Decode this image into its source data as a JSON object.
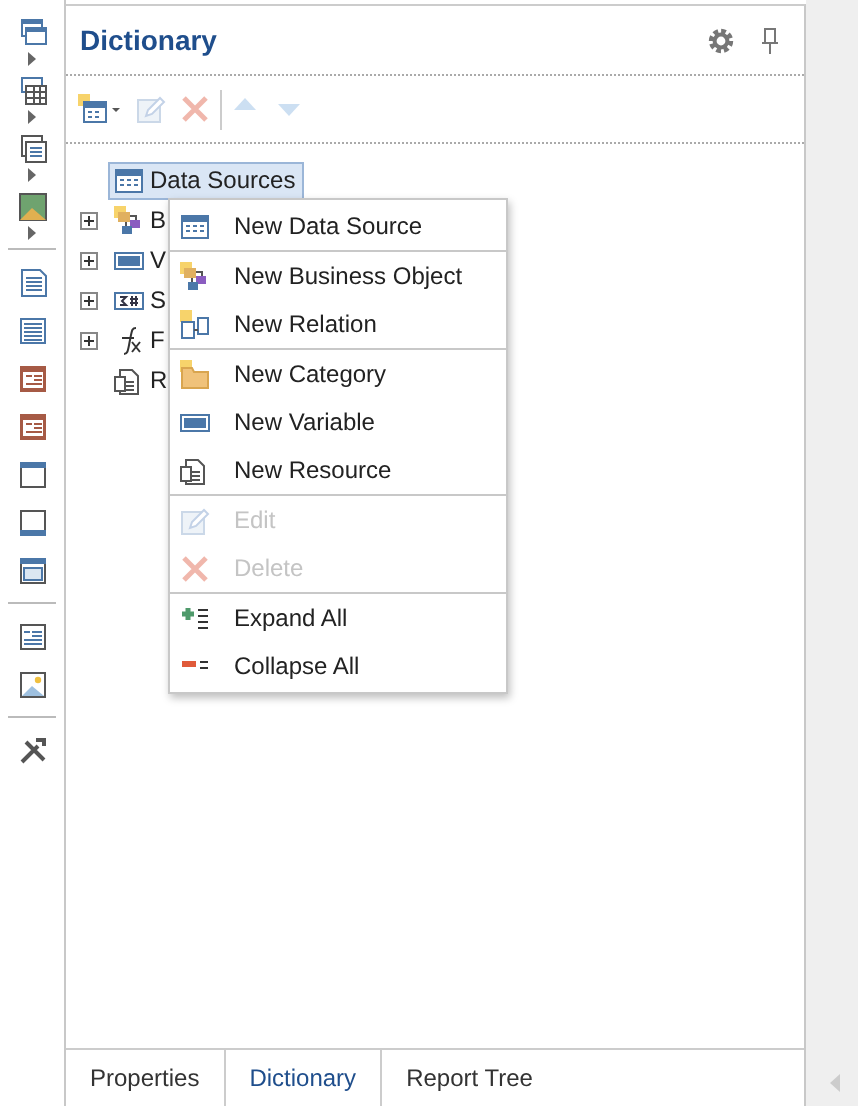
{
  "panel": {
    "title": "Dictionary"
  },
  "toolbar": [
    {
      "kind": "new",
      "disabled": false
    },
    {
      "kind": "edit",
      "disabled": true
    },
    {
      "kind": "delete",
      "disabled": true
    },
    {
      "kind": "separator"
    },
    {
      "kind": "up",
      "disabled": true
    },
    {
      "kind": "down",
      "disabled": true
    }
  ],
  "tree": [
    {
      "label": "Data Sources",
      "kind": "datasource",
      "expandable": false,
      "selected": true
    },
    {
      "label": "B",
      "kind": "business",
      "expandable": true,
      "selected": false
    },
    {
      "label": "V",
      "kind": "variable",
      "expandable": true,
      "selected": false
    },
    {
      "label": "S",
      "kind": "sum",
      "expandable": true,
      "selected": false
    },
    {
      "label": "F",
      "kind": "function",
      "expandable": true,
      "selected": false
    },
    {
      "label": "R",
      "kind": "resource",
      "expandable": false,
      "selected": false
    }
  ],
  "context_menu": {
    "groups": [
      [
        {
          "label": "New Data Source",
          "kind": "datasource",
          "disabled": false
        }
      ],
      [
        {
          "label": "New Business Object",
          "kind": "business",
          "disabled": false
        },
        {
          "label": "New Relation",
          "kind": "relation",
          "disabled": false
        }
      ],
      [
        {
          "label": "New Category",
          "kind": "category",
          "disabled": false
        },
        {
          "label": "New Variable",
          "kind": "variable",
          "disabled": false
        },
        {
          "label": "New Resource",
          "kind": "resource",
          "disabled": false
        }
      ],
      [
        {
          "label": "Edit",
          "kind": "edit",
          "disabled": true
        },
        {
          "label": "Delete",
          "kind": "delete",
          "disabled": true
        }
      ],
      [
        {
          "label": "Expand All",
          "kind": "expand",
          "disabled": false
        },
        {
          "label": "Collapse All",
          "kind": "collapse",
          "disabled": false
        }
      ]
    ]
  },
  "bottom_tabs": [
    {
      "label": "Properties",
      "selected": false
    },
    {
      "label": "Dictionary",
      "selected": true
    },
    {
      "label": "Report Tree",
      "selected": false
    }
  ]
}
